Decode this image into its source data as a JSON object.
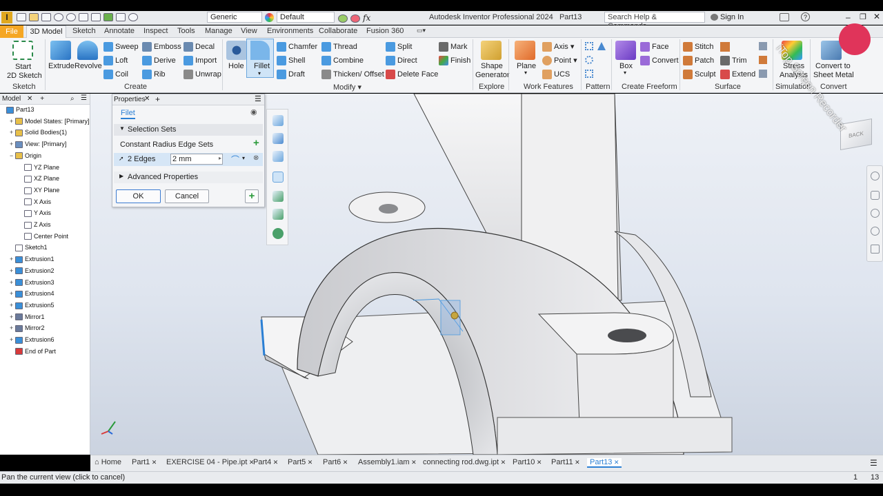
{
  "app": {
    "title": "Autodesk Inventor Professional 2024",
    "document": "Part13",
    "logo": "I",
    "search_placeholder": "Search Help & Commands...",
    "signin": "Sign In",
    "watermark": "iTop Screen Recorder"
  },
  "quick_access": {
    "material": "Generic",
    "appearance": "Default"
  },
  "menus": [
    "File",
    "3D Model",
    "Sketch",
    "Annotate",
    "Inspect",
    "Tools",
    "Manage",
    "View",
    "Environments",
    "Collaborate",
    "Fusion 360"
  ],
  "ribbon": {
    "sketch": {
      "start": "Start",
      "sketch2d": "2D Sketch",
      "group": "Sketch"
    },
    "create": {
      "extrude": "Extrude",
      "revolve": "Revolve",
      "sweep": "Sweep",
      "loft": "Loft",
      "coil": "Coil",
      "emboss": "Emboss",
      "derive": "Derive",
      "rib": "Rib",
      "decal": "Decal",
      "import": "Import",
      "unwrap": "Unwrap",
      "group": "Create"
    },
    "modify": {
      "hole": "Hole",
      "fillet": "Fillet",
      "chamfer": "Chamfer",
      "shell": "Shell",
      "draft": "Draft",
      "thread": "Thread",
      "combine": "Combine",
      "thicken": "Thicken/ Offset",
      "split": "Split",
      "direct": "Direct",
      "delete_face": "Delete Face",
      "mark": "Mark",
      "finish": "Finish",
      "group": "Modify"
    },
    "explore": {
      "shape1": "Shape",
      "shape2": "Generator",
      "group": "Explore"
    },
    "work": {
      "plane": "Plane",
      "axis": "Axis",
      "point": "Point",
      "ucs": "UCS",
      "group": "Work Features"
    },
    "pattern": {
      "group": "Pattern"
    },
    "freeform": {
      "box": "Box",
      "face": "Face",
      "convert": "Convert",
      "group": "Create Freeform"
    },
    "surface": {
      "stitch": "Stitch",
      "patch": "Patch",
      "sculpt": "Sculpt",
      "trim": "Trim",
      "extend": "Extend",
      "group": "Surface"
    },
    "simulation": {
      "stress1": "Stress",
      "stress2": "Analysis",
      "group": "Simulation"
    },
    "convert": {
      "c1": "Convert to",
      "c2": "Sheet Metal",
      "group": "Convert"
    }
  },
  "browser": {
    "tab": "Model",
    "items": [
      {
        "label": "Part13",
        "icon": "part-icon",
        "color": "#3a8fd8",
        "indent": 0,
        "expander": ""
      },
      {
        "label": "Model States: [Primary]",
        "icon": "folder-icon",
        "color": "#e8c04a",
        "indent": 1,
        "expander": "+"
      },
      {
        "label": "Solid Bodies(1)",
        "icon": "folder-icon",
        "color": "#e8c04a",
        "indent": 1,
        "expander": "+"
      },
      {
        "label": "View: [Primary]",
        "icon": "view-icon",
        "color": "#6a8fbf",
        "indent": 1,
        "expander": "+"
      },
      {
        "label": "Origin",
        "icon": "folder-icon",
        "color": "#e8c04a",
        "indent": 1,
        "expander": "−"
      },
      {
        "label": "YZ Plane",
        "icon": "plane-icon",
        "color": "#ffffff",
        "indent": 2,
        "expander": ""
      },
      {
        "label": "XZ Plane",
        "icon": "plane-icon",
        "color": "#ffffff",
        "indent": 2,
        "expander": ""
      },
      {
        "label": "XY Plane",
        "icon": "plane-icon",
        "color": "#ffffff",
        "indent": 2,
        "expander": ""
      },
      {
        "label": "X Axis",
        "icon": "axis-icon",
        "color": "#ffffff",
        "indent": 2,
        "expander": ""
      },
      {
        "label": "Y Axis",
        "icon": "axis-icon",
        "color": "#ffffff",
        "indent": 2,
        "expander": ""
      },
      {
        "label": "Z Axis",
        "icon": "axis-icon",
        "color": "#ffffff",
        "indent": 2,
        "expander": ""
      },
      {
        "label": "Center Point",
        "icon": "point-icon",
        "color": "#ffffff",
        "indent": 2,
        "expander": ""
      },
      {
        "label": "Sketch1",
        "icon": "sketch-icon",
        "color": "#ffffff",
        "indent": 1,
        "expander": ""
      },
      {
        "label": "Extrusion1",
        "icon": "extrusion-icon",
        "color": "#3a8fd8",
        "indent": 1,
        "expander": "+"
      },
      {
        "label": "Extrusion2",
        "icon": "extrusion-icon",
        "color": "#3a8fd8",
        "indent": 1,
        "expander": "+"
      },
      {
        "label": "Extrusion3",
        "icon": "extrusion-icon",
        "color": "#3a8fd8",
        "indent": 1,
        "expander": "+"
      },
      {
        "label": "Extrusion4",
        "icon": "extrusion-icon",
        "color": "#3a8fd8",
        "indent": 1,
        "expander": "+"
      },
      {
        "label": "Extrusion5",
        "icon": "extrusion-icon",
        "color": "#3a8fd8",
        "indent": 1,
        "expander": "+"
      },
      {
        "label": "Mirror1",
        "icon": "mirror-icon",
        "color": "#6a7a9a",
        "indent": 1,
        "expander": "+"
      },
      {
        "label": "Mirror2",
        "icon": "mirror-icon",
        "color": "#6a7a9a",
        "indent": 1,
        "expander": "+"
      },
      {
        "label": "Extrusion6",
        "icon": "extrusion-icon",
        "color": "#3a8fd8",
        "indent": 1,
        "expander": "+"
      },
      {
        "label": "End of Part",
        "icon": "end-of-part-icon",
        "color": "#d83a3a",
        "indent": 1,
        "expander": ""
      }
    ]
  },
  "properties": {
    "tab": "Properties",
    "title": "Filet",
    "section": "Selection Sets",
    "set_label": "Constant Radius Edge Sets",
    "edges": "2 Edges",
    "radius": "2 mm",
    "advanced": "Advanced Properties",
    "ok": "OK",
    "cancel": "Cancel"
  },
  "viewcube": {
    "label": "BACK"
  },
  "doc_tabs": [
    "Home",
    "Part1",
    "EXERCISE 04 - Pipe.ipt",
    "Part4",
    "Part5",
    "Part6",
    "Assembly1.iam",
    "connecting rod.dwg.ipt",
    "Part10",
    "Part11",
    "Part13"
  ],
  "status": {
    "message": "Pan the current view (click to cancel)",
    "num1": "1",
    "num2": "13"
  }
}
